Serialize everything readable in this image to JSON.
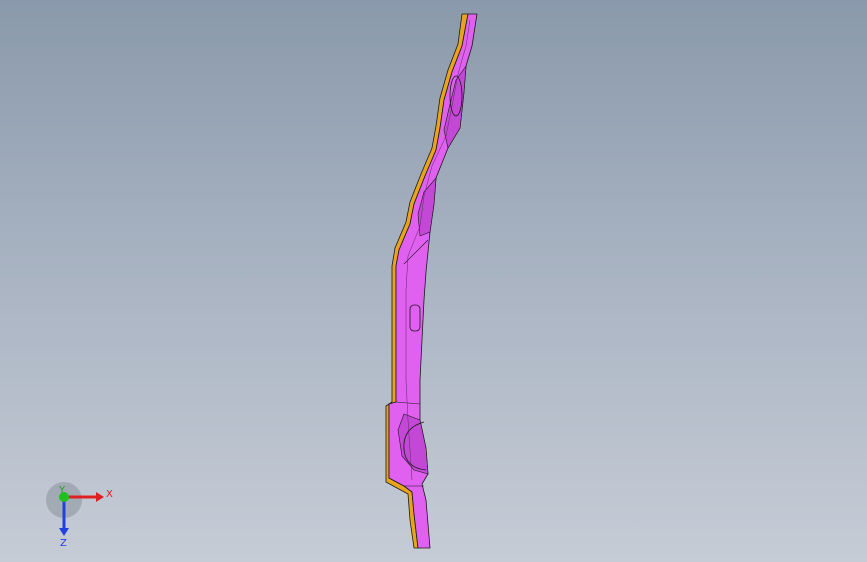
{
  "viewport": {
    "background_top": "#8a99ab",
    "background_bottom": "#c6ccd6"
  },
  "model": {
    "face_color": "#e060f0",
    "face_shade": "#c448d6",
    "edge_color": "#e7a41c",
    "edge_shade": "#c98812",
    "outline_color": "#1a1a1a"
  },
  "triad": {
    "x_label": "X",
    "y_label": "Y",
    "z_label": "Z",
    "x_color": "#e02020",
    "y_color": "#20c020",
    "z_color": "#2040e0"
  }
}
